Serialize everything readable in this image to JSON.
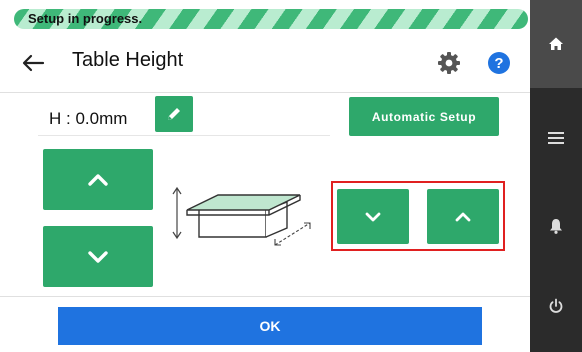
{
  "progress": {
    "label": "Setup in progress."
  },
  "header": {
    "title": "Table Height"
  },
  "height": {
    "value": "H : 0.0mm"
  },
  "buttons": {
    "automatic_setup": "Automatic Setup",
    "ok": "OK"
  },
  "sidebar": {
    "items": [
      {
        "name": "home"
      },
      {
        "name": "menu"
      },
      {
        "name": "notifications"
      },
      {
        "name": "power"
      }
    ]
  },
  "icons": {
    "back": "arrow-left-icon",
    "settings": "gear-icon",
    "help": "help-icon",
    "edit": "pencil-icon",
    "up": "chevron-up-icon",
    "down": "chevron-down-icon"
  },
  "colors": {
    "accent_green": "#2ea86b",
    "primary_blue": "#1f73e0",
    "highlight_red": "#e02020",
    "sidebar_bg": "#2b2b2b",
    "progress_stripe": "#3fb879"
  }
}
